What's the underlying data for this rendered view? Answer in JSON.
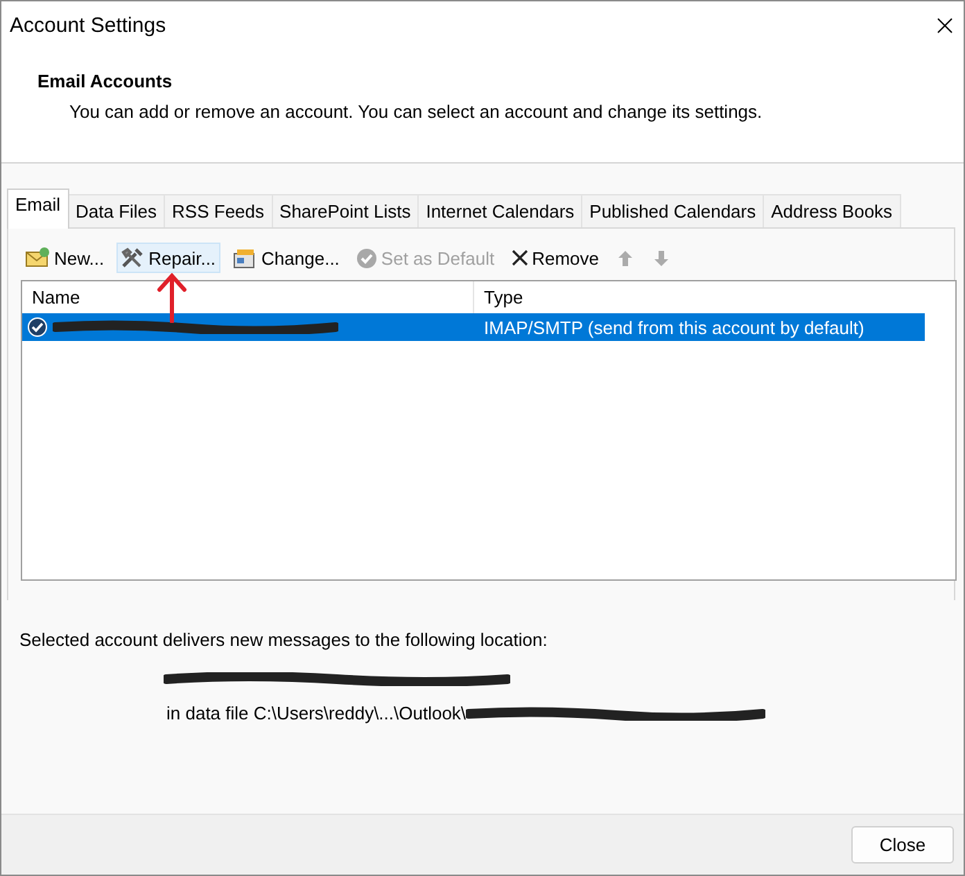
{
  "window": {
    "title": "Account Settings"
  },
  "header": {
    "title": "Email Accounts",
    "description": "You can add or remove an account. You can select an account and change its settings."
  },
  "tabs": [
    {
      "label": "Email",
      "selected": true
    },
    {
      "label": "Data Files",
      "selected": false
    },
    {
      "label": "RSS Feeds",
      "selected": false
    },
    {
      "label": "SharePoint Lists",
      "selected": false
    },
    {
      "label": "Internet Calendars",
      "selected": false
    },
    {
      "label": "Published Calendars",
      "selected": false
    },
    {
      "label": "Address Books",
      "selected": false
    }
  ],
  "toolbar": [
    {
      "kind": "new",
      "label": "New...",
      "disabled": false,
      "highlighted": false
    },
    {
      "kind": "repair",
      "label": "Repair...",
      "disabled": false,
      "highlighted": true
    },
    {
      "kind": "change",
      "label": "Change...",
      "disabled": false,
      "highlighted": false
    },
    {
      "kind": "default",
      "label": "Set as Default",
      "disabled": true,
      "highlighted": false
    },
    {
      "kind": "remove",
      "label": "Remove",
      "disabled": false,
      "highlighted": false
    },
    {
      "kind": "up",
      "disabled": true,
      "highlighted": false
    },
    {
      "kind": "down",
      "disabled": true,
      "highlighted": false
    }
  ],
  "accounts": {
    "columns": [
      "Name",
      "Type"
    ],
    "rows": [
      {
        "type": "IMAP/SMTP (send from this account by default)",
        "selected": true,
        "default": true
      }
    ]
  },
  "delivery": {
    "label": "Selected account delivers new messages to the following location:",
    "data_file_prefix": "in data file C:\\Users\\reddy\\...\\Outlook\\"
  },
  "annotation": {
    "kind": "arrow"
  },
  "buttons": [
    {
      "label": "Close"
    }
  ]
}
